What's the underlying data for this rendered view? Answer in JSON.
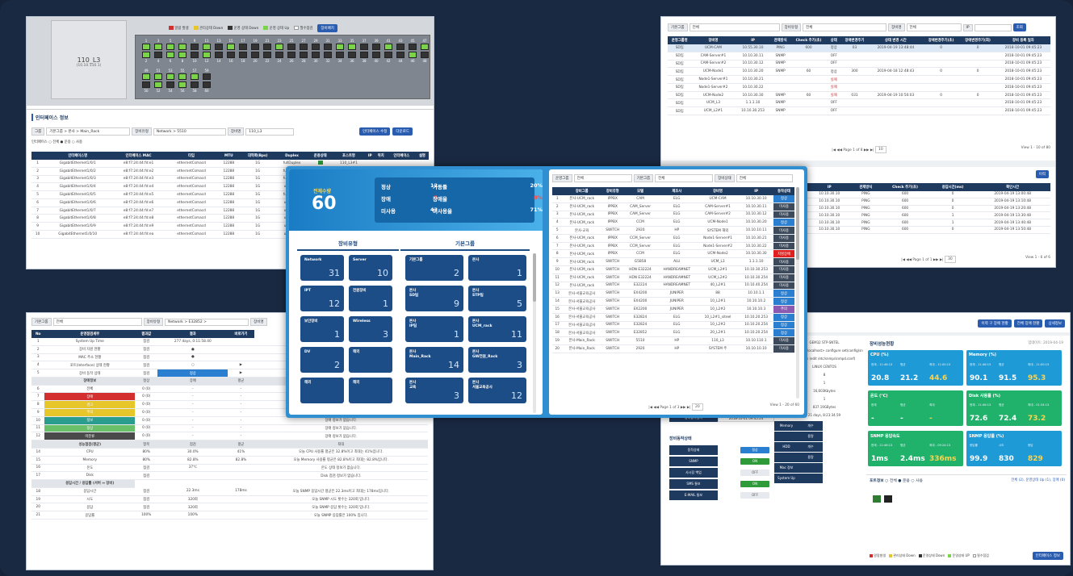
{
  "win1": {
    "device": "110_L3",
    "device_ip": "(10.10.110.1)",
    "legend": [
      "알람 발생",
      "관리상태 Down",
      "운영 상태 Down",
      "운영 상태 Up",
      "필수점검"
    ],
    "legend_btn": "장비배치",
    "ports_top": [
      "1",
      "3",
      "5",
      "7",
      "9",
      "11",
      "13",
      "15",
      "17",
      "19",
      "21",
      "23",
      "25",
      "27",
      "29",
      "31",
      "33",
      "35",
      "37",
      "39",
      "41",
      "43",
      "45",
      "47"
    ],
    "ports_bot": [
      "2",
      "4",
      "6",
      "8",
      "10",
      "12",
      "14",
      "16",
      "18",
      "20",
      "22",
      "24",
      "26",
      "28",
      "30",
      "32",
      "34",
      "36",
      "38",
      "40",
      "42",
      "44",
      "46",
      "48"
    ],
    "ports_top2": [
      "49",
      "51",
      "53",
      "55",
      "57",
      "59"
    ],
    "ports_bot2": [
      "50",
      "52",
      "54",
      "56",
      "58",
      "60"
    ],
    "section": "인터페이스 정보",
    "group_lbl": "그룹",
    "group_val": "기본그룹 > 본사 > Main_Rack",
    "type_lbl": "장비유형",
    "type_val": "Network > 5510",
    "name_lbl": "장비명",
    "name_val": "110_L3",
    "edit_btn": "인터페이스 수정",
    "down_btn": "다운로드",
    "filter_lbl": "인터페이스",
    "filter": [
      "전체",
      "운용",
      "사용"
    ],
    "cols": [
      "",
      "인터페이스명",
      "인터페이스 MAC",
      "타입",
      "MTU",
      "대역폭(Bps)",
      "Duplex",
      "운용상태",
      "포스트명",
      "IP",
      "위치",
      "인터페이스",
      "설명"
    ],
    "rows": [
      [
        "1",
        "GigabitEthernet1/0/1",
        "e8:f7:24:44:fd:e1",
        "ethernetCsmacd",
        "12288",
        "1G",
        "fullDuplex",
        "",
        "110_L3#1"
      ],
      [
        "2",
        "GigabitEthernet1/0/2",
        "e8:f7:24:44:fd:e2",
        "ethernetCsmacd",
        "12288",
        "1G",
        "fullDuplex",
        "",
        ""
      ],
      [
        "3",
        "GigabitEthernet1/0/3",
        "e8:f7:24:44:fd:e3",
        "ethernetCsmacd",
        "12288",
        "1G",
        "fullDuplex",
        "",
        ""
      ],
      [
        "4",
        "GigabitEthernet1/0/4",
        "e8:f7:24:44:fd:e4",
        "ethernetCsmacd",
        "12288",
        "1G",
        "unknown",
        "",
        ""
      ],
      [
        "5",
        "GigabitEthernet1/0/5",
        "e8:f7:24:44:fd:e5",
        "ethernetCsmacd",
        "12288",
        "1G",
        "fullDuplex",
        "",
        "120_L2#1"
      ],
      [
        "6",
        "GigabitEthernet1/0/6",
        "e8:f7:24:44:fd:e6",
        "ethernetCsmacd",
        "12288",
        "1G",
        "unknown",
        "",
        ""
      ],
      [
        "7",
        "GigabitEthernet1/0/7",
        "e8:f7:24:44:fd:e7",
        "ethernetCsmacd",
        "12288",
        "1G",
        "unknown",
        "",
        ""
      ],
      [
        "8",
        "GigabitEthernet1/0/8",
        "e8:f7:24:44:fd:e8",
        "ethernetCsmacd",
        "12288",
        "1G",
        "unknown",
        "",
        ""
      ],
      [
        "9",
        "GigabitEthernet1/0/9",
        "e8:f7:24:44:fd:e9",
        "ethernetCsmacd",
        "12288",
        "1G",
        "unknown",
        "",
        ""
      ],
      [
        "10",
        "GigabitEthernet1/0/10",
        "e8:f7:24:44:fd:ea",
        "ethernetCsmacd",
        "12288",
        "1G",
        "unknown",
        "",
        ""
      ]
    ]
  },
  "win2": {
    "f1_lbl": "기본그룹",
    "f1_val": "전체",
    "f2_lbl": "장비유형",
    "f2_val": "전체",
    "f3_lbl": "장비명",
    "f3_val": "전체",
    "f4_lbl": "IP",
    "search": "조회",
    "cols": [
      "운영그룹명",
      "장비명",
      "IP",
      "관제방식",
      "Check 주기(초)",
      "상태",
      "장애변경주기",
      "상태 변경 시간",
      "장애변경주기(초)",
      "장애변경주기(회)",
      "장비 등록 일자"
    ],
    "rows": [
      [
        "SD팀",
        "UCM-CAM",
        "10.55.30.10",
        "PING",
        "600",
        "정상",
        "03",
        "2019-04-19 13:48:44",
        "0",
        "0",
        "2018-10-01 09:45:23"
      ],
      [
        "SD팀",
        "CAM-Server#1",
        "10.10.30.11",
        "SNMP",
        "",
        "OFF",
        "",
        "",
        "",
        "",
        "2018-10-01 09:45:23"
      ],
      [
        "SD팀",
        "CAM-Server#2",
        "10.10.30.12",
        "SNMP",
        "",
        "OFF",
        "",
        "",
        "",
        "",
        "2018-10-01 09:45:23"
      ],
      [
        "SD팀",
        "UCM-Node1",
        "10.10.30.20",
        "SNMP",
        "60",
        "정상",
        "300",
        "2019-04-18 12:48:43",
        "0",
        "0",
        "2018-10-01 09:45:23"
      ],
      [
        "SD팀",
        "Node1-Server#1",
        "10.10.30.21",
        "",
        "",
        "실패",
        "",
        "",
        "",
        "",
        "2018-10-01 09:45:23"
      ],
      [
        "SD팀",
        "Node1-Server#2",
        "10.10.30.22",
        "",
        "",
        "실패",
        "",
        "",
        "",
        "",
        "2018-10-01 09:45:23"
      ],
      [
        "SD팀",
        "UCM-Node2",
        "10.10.30.30",
        "SNMP",
        "60",
        "실패",
        "031",
        "2019-04-19 10:50:03",
        "0",
        "0",
        "2018-10-01 09:45:23"
      ],
      [
        "SD팀",
        "UCM_L3",
        "1.1.1.10",
        "SNMP",
        "",
        "OFF",
        "",
        "",
        "",
        "",
        "2018-10-01 09:45:23"
      ],
      [
        "SD팀",
        "UCM_L2#1",
        "10.10.30.253",
        "SNMP",
        "",
        "OFF",
        "",
        "",
        "",
        "",
        "2018-10-01 09:45:23"
      ]
    ],
    "pager": "Page 1 of 8",
    "per": "10",
    "count": "View 1 - 10 of 80",
    "sub_btn": "이력",
    "sub_cols": [
      "IP",
      "관제방식",
      "Check 주기(초)",
      "응답시간(ms)",
      "확인시간"
    ],
    "sub_rows": [
      [
        "10.10.30.10",
        "PING",
        "600",
        "0",
        "2019-04-19 13:00:48"
      ],
      [
        "10.10.30.10",
        "PING",
        "600",
        "0",
        "2019-04-19 13:10:48"
      ],
      [
        "10.10.30.10",
        "PING",
        "600",
        "0",
        "2019-04-19 13:20:48"
      ],
      [
        "10.10.30.10",
        "PING",
        "600",
        "1",
        "2019-04-19 13:30:48"
      ],
      [
        "10.10.30.10",
        "PING",
        "600",
        "1",
        "2019-04-19 13:40:48"
      ],
      [
        "10.10.30.10",
        "PING",
        "600",
        "0",
        "2019-04-19 13:50:48"
      ]
    ],
    "sub_pager": "Page 1 of 1",
    "sub_per": "30",
    "sub_count": "View 1 - 6 of 6"
  },
  "win3": {
    "f1_lbl": "기본그룹",
    "f1_val": "전체",
    "f2_lbl": "장비유형",
    "f2_val": "Network > E32852 >",
    "f3_lbl": "장비명",
    "cols": [
      "No",
      "운영점검세부",
      "결과값",
      "결과",
      "바로가기"
    ],
    "rows": [
      [
        "1",
        "System Up Time",
        "점검",
        "277 days, 0:11:58.40",
        "",
        "결과 시간: 277"
      ],
      [
        "2",
        "장비 자원 현황",
        "점검",
        "●",
        "",
        "장"
      ],
      [
        "3",
        "MAC 주소 현황",
        "점검",
        "●",
        "",
        "MAC 주"
      ],
      [
        "4",
        "포트(Interface) 상태 현황",
        "점검",
        "○",
        "▶",
        "현장화 포트(I)"
      ],
      [
        "5",
        "장비 동작 상태",
        "점검",
        "정상",
        "▶",
        "장비 동작"
      ]
    ],
    "sub_cols": [
      "정상",
      "장애",
      "평균",
      "최대"
    ],
    "status_rows": [
      [
        "6",
        "전체",
        "0 (0)",
        "-",
        "-",
        "장애 정보가 없습니다."
      ],
      [
        "7",
        "장애",
        "0 (0)",
        "-",
        "-",
        "장애 정보가 없습니다."
      ],
      [
        "8",
        "경고",
        "0 (0)",
        "-",
        "-",
        "장애 정보가 없습니다."
      ],
      [
        "9",
        "주의",
        "0 (0)",
        "-",
        "-",
        "장애 정보가 없습니다."
      ],
      [
        "10",
        "정보",
        "0 (0)",
        "-",
        "-",
        "장애 정보가 없습니다."
      ],
      [
        "11",
        "정상",
        "0 (0)",
        "-",
        "-",
        "장애 정보가 없습니다."
      ],
      [
        "12",
        "미분류",
        "0 (0)",
        "-",
        "-",
        "장애 정보가 없습니다."
      ]
    ],
    "status_title": "장애정보",
    "perf_title": "성능점검(평균)",
    "perf_hdr": [
      "항목",
      "점검",
      "평균",
      "최대"
    ],
    "perf_rows": [
      [
        "14",
        "CPU",
        "80%",
        "30.0%",
        "41%",
        "오늘 CPU 사용률 평균은 32.8%이고 최대는 41%입니다."
      ],
      [
        "15",
        "Memory",
        "80%",
        "82.8%",
        "82.8%",
        "오늘 Memory 사용률 평균은 82.8%이고 최대는 82.8%입니다."
      ],
      [
        "16",
        "온도",
        "점검",
        "37℃",
        "",
        "온도 상태 정보가 없습니다."
      ],
      [
        "17",
        "Disk",
        "점검",
        "",
        "",
        "Disk 점검 정보가 없습니다."
      ]
    ],
    "resp_title": "응답시간 / 응답률 (서버 ↔ 장비)",
    "resp_rows": [
      [
        "18",
        "응답시간",
        "점검",
        "22.3ms",
        "178ms",
        "오늘 SNMP 응답시간 평균은 22.3ms이고 최대는 178ms입니다."
      ],
      [
        "19",
        "시도",
        "점검",
        "320회",
        "",
        "오늘 SNMP 시도 횟수는 320회 입니다."
      ],
      [
        "20",
        "응답",
        "점검",
        "320회",
        "",
        "오늘 SNMP 응답 횟수는 320회 입니다."
      ],
      [
        "21",
        "응답률",
        "100%",
        "100%",
        "",
        "오늘 SNMP 응답률은 100% 입니다."
      ]
    ],
    "dates": [
      "2018-04-19 00:00",
      "2019-04-19 13:50",
      "(현재시간)"
    ]
  },
  "dash": {
    "total_lbl": "전체수량",
    "total": "60",
    "stats": [
      [
        "정상",
        "12",
        "가동률",
        "20%"
      ],
      [
        "장애",
        "5",
        "장애율",
        "8%"
      ],
      [
        "미사용",
        "43",
        "미사용율",
        "71%"
      ]
    ],
    "types_title": "장비유형",
    "groups_title": "기본그룹",
    "types": [
      [
        "Network",
        "31"
      ],
      [
        "Server",
        "10"
      ],
      [
        "IPT",
        "12"
      ],
      [
        "전원장비",
        "1"
      ],
      [
        "보안장비",
        "1"
      ],
      [
        "Wireless",
        "3"
      ],
      [
        "DV",
        "2"
      ],
      [
        "해외",
        ""
      ],
      [
        "해외",
        ""
      ],
      [
        "해외",
        ""
      ]
    ],
    "groups": [
      [
        "기본그룹",
        "2"
      ],
      [
        "본사",
        "1"
      ],
      [
        "본사\nSD팀",
        "9"
      ],
      [
        "본사\nSTP팀",
        "5"
      ],
      [
        "본사\nIP팀",
        "1"
      ],
      [
        "본사\nUCM_rack",
        "11"
      ],
      [
        "본사\nMain_Rack",
        "14"
      ],
      [
        "본사\nGW전원_Rack",
        "3"
      ],
      [
        "본사\n교육",
        "3"
      ],
      [
        "본사\n서울교육공사",
        "12"
      ]
    ],
    "f1_lbl": "운영그룹",
    "f1_val": "전체",
    "f2_lbl": "기본그룹",
    "f2_val": "전체",
    "f3_lbl": "장비상태",
    "f3_val": "전체",
    "cols": [
      "",
      "장비그룹",
      "장비유형",
      "모델",
      "제조사",
      "장비명",
      "IP",
      "동작상태"
    ],
    "rows": [
      [
        "1",
        "본사-UCM_rack",
        "IPPBX",
        "CAM",
        "ELG",
        "UCM-CAM",
        "10.10.30.10",
        "정상"
      ],
      [
        "2",
        "본사-UCM_rack",
        "IPPBX",
        "CAM_Server",
        "ELG",
        "CAM-Server#1",
        "10.10.30.11",
        "미사용"
      ],
      [
        "3",
        "본사-UCM_rack",
        "IPPBX",
        "CAM_Server",
        "ELG",
        "CAM-Server#2",
        "10.10.30.12",
        "미사용"
      ],
      [
        "4",
        "본사-UCM_rack",
        "IPPBX",
        "CCM",
        "ELG",
        "UCM-Node1",
        "10.10.30.20",
        "정상"
      ],
      [
        "5",
        "본사-교육",
        "SWITCH",
        "2920",
        "HP",
        "SYSTEM 해외",
        "10.10.10.11",
        "미사용"
      ],
      [
        "6",
        "본사-UCM_rack",
        "IPPBX",
        "CCM_Server",
        "ELG",
        "Node1-Server#1",
        "10.10.30.21",
        "미사용"
      ],
      [
        "7",
        "본사-UCM_rack",
        "IPPBX",
        "CCM_Server",
        "ELG",
        "Node1-Server#2",
        "10.10.30.22",
        "미사용"
      ],
      [
        "8",
        "본사-UCM_rack",
        "IPPBX",
        "CCM",
        "ELG",
        "UCM-Node2",
        "10.10.30.30",
        "치명장애"
      ],
      [
        "9",
        "본사-UCM_rack",
        "SWITCH",
        "G5B58",
        "ALU",
        "UCM_L3",
        "1.1.1.10",
        "미사용"
      ],
      [
        "10",
        "본사-UCM_rack",
        "SWITCH",
        "HDN E32224",
        "HANDREAMNET",
        "UCM_L2#1",
        "10.10.30.253",
        "미사용"
      ],
      [
        "11",
        "본사-UCM_rack",
        "SWITCH",
        "HDN E32224",
        "HANDREAMNET",
        "UCM_L2#2",
        "10.10.30.254",
        "미사용"
      ],
      [
        "12",
        "본사-UCM_rack",
        "SWITCH",
        "E32224",
        "HANDREAMNET",
        "40_L2#1",
        "10.10.40.254",
        "미사용"
      ],
      [
        "13",
        "본사-서울교육공사",
        "SWITCH",
        "EX4200",
        "JUNIPER",
        "88",
        "10.10.1.1",
        "정상"
      ],
      [
        "14",
        "본사-서울교육공사",
        "SWITCH",
        "EX4200",
        "JUNIPER",
        "10_L2#1",
        "10.10.10.2",
        "정상"
      ],
      [
        "15",
        "본사-서울교육공사",
        "SWITCH",
        "EX2200",
        "JUNIPER",
        "10_L2#2",
        "10.10.10.3",
        "주의"
      ],
      [
        "16",
        "본사-서울교육공사",
        "SWITCH",
        "E32824",
        "ELG",
        "10_L2#1_siteel",
        "10.10.20.253",
        "정상"
      ],
      [
        "17",
        "본사-서울교육공사",
        "SWITCH",
        "E32824",
        "ELG",
        "10_L2#2",
        "10.10.20.254",
        "정상"
      ],
      [
        "18",
        "본사-서울교육공사",
        "SWITCH",
        "E32852",
        "ELG",
        "20_L2#1",
        "10.10.20.254",
        "정상"
      ],
      [
        "19",
        "본사-Main_Rack",
        "SWITCH",
        "5510",
        "HP",
        "110_L3",
        "10.10.110.1",
        "미사용"
      ],
      [
        "20",
        "본사-Main_Rack",
        "SWITCH",
        "2920",
        "HP",
        "SYSTEM 주",
        "10.10.10.10",
        "미사용"
      ]
    ],
    "pager": "Page 1 of 3",
    "per": "20",
    "count": "View 1 - 20 of 60"
  },
  "win5": {
    "buttons": [
      "이력 구 장애 현황",
      "전체 장애 현황",
      "상세정보"
    ],
    "perf_title": "장비성능현황",
    "updated": "업데이트: 2019-04-19",
    "cards": [
      [
        "CPU (%)",
        "현재 - 11:46:13",
        "평균",
        "최대 - 11:00:13",
        "20.8",
        "21.2",
        "44.6"
      ],
      [
        "Memory (%)",
        "현재 - 11:46:13",
        "평균",
        "최대 - 11:00:13",
        "90.1",
        "91.5",
        "95.3"
      ],
      [
        "온도 (℃)",
        "현재",
        "평균",
        "최대",
        "-",
        "-",
        "-"
      ],
      [
        "Disk 사용률 (%)",
        "현재 - 11:46:13",
        "평균",
        "최대 - 01:34:13",
        "72.6",
        "72.4",
        "73.2"
      ],
      [
        "SNMP 응답속도",
        "현재 - 11:46:13",
        "평균",
        "최대 - 09:24:13",
        "1ms",
        "2.4ms",
        "336ms"
      ],
      [
        "SNMP 응답률 (%)",
        "응답률",
        "시도",
        "응답",
        "99.9",
        "830",
        "829"
      ]
    ],
    "info": [
      "GEM32 STP-SNTEL",
      "Host: <root@localhost> configure set(config)snmp.local.conf)",
      "Unknown (edit /etc/snmp/snmpd.conf)",
      "LINUX CENTOS",
      "8",
      "1",
      "16,603Kbytes",
      "1",
      "837.19GBytes",
      "21 days, 8:23:34.59"
    ],
    "left_labels": [
      "담당자",
      "장비등록일자"
    ],
    "left_vals": [
      "김철",
      "2018-10-01 09:45:24"
    ],
    "grid_rows": [
      [
        "Memory",
        "개수"
      ],
      [
        "",
        "용량"
      ],
      [
        "HDD",
        "개수"
      ],
      [
        "",
        "용량"
      ],
      [
        "Mac 정보",
        ""
      ],
      [
        "System Up Time",
        ""
      ]
    ],
    "op_title": "장비동작상태",
    "op_rows": [
      [
        "동작상태",
        "정상"
      ],
      [
        "SNMP",
        "ON"
      ],
      [
        "사시장 백업",
        "OFF"
      ],
      [
        "SMS 통보",
        "ON"
      ],
      [
        "E-MAIL 통보",
        "OFF"
      ]
    ],
    "port_title": "포트정보",
    "port_filter": [
      "전체",
      "운용",
      "사용"
    ],
    "port_note": "전체 (2), 운영상태 Up (1), 장애 (0)",
    "legend": [
      "알람발생",
      "관리상태 Down",
      "운영상태 Down",
      "운영상태 UP",
      "필수점검"
    ],
    "port_btn": "인터페이스 정보"
  }
}
